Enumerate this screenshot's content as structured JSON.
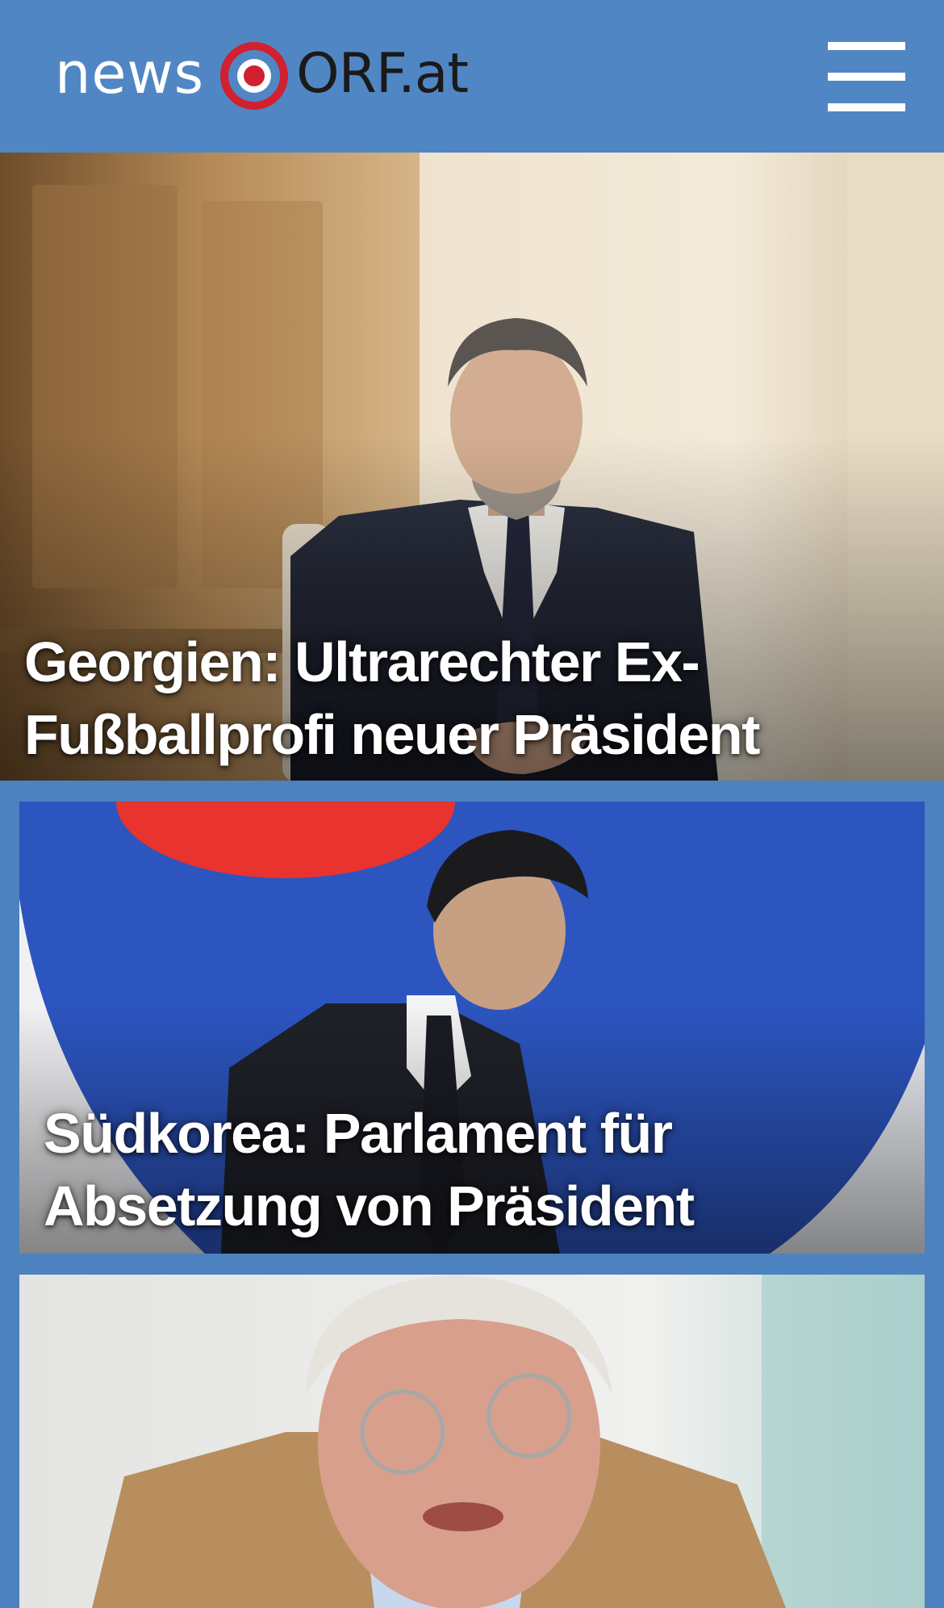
{
  "header": {
    "logo": {
      "news_text": "news",
      "orf_text": "ORF.at",
      "target_icon": "orf-target-icon",
      "target_color": "#d1202f"
    },
    "menu_icon": "hamburger-menu-icon",
    "background_color": "#5186c4"
  },
  "teasers": [
    {
      "title": "Georgien: Ultrarechter Ex-Fußballprofi neuer Präsident",
      "image_description": "man-in-dark-suit-hand-on-chest"
    },
    {
      "title": "Südkorea: Parlament für Absetzung von Präsident",
      "image_description": "man-in-suit-before-korean-flag"
    },
    {
      "title": "",
      "image_description": "elderly-man-with-glasses-tan-jacket"
    }
  ],
  "colors": {
    "page_background": "#4c82bf",
    "title_text": "#ffffff"
  }
}
